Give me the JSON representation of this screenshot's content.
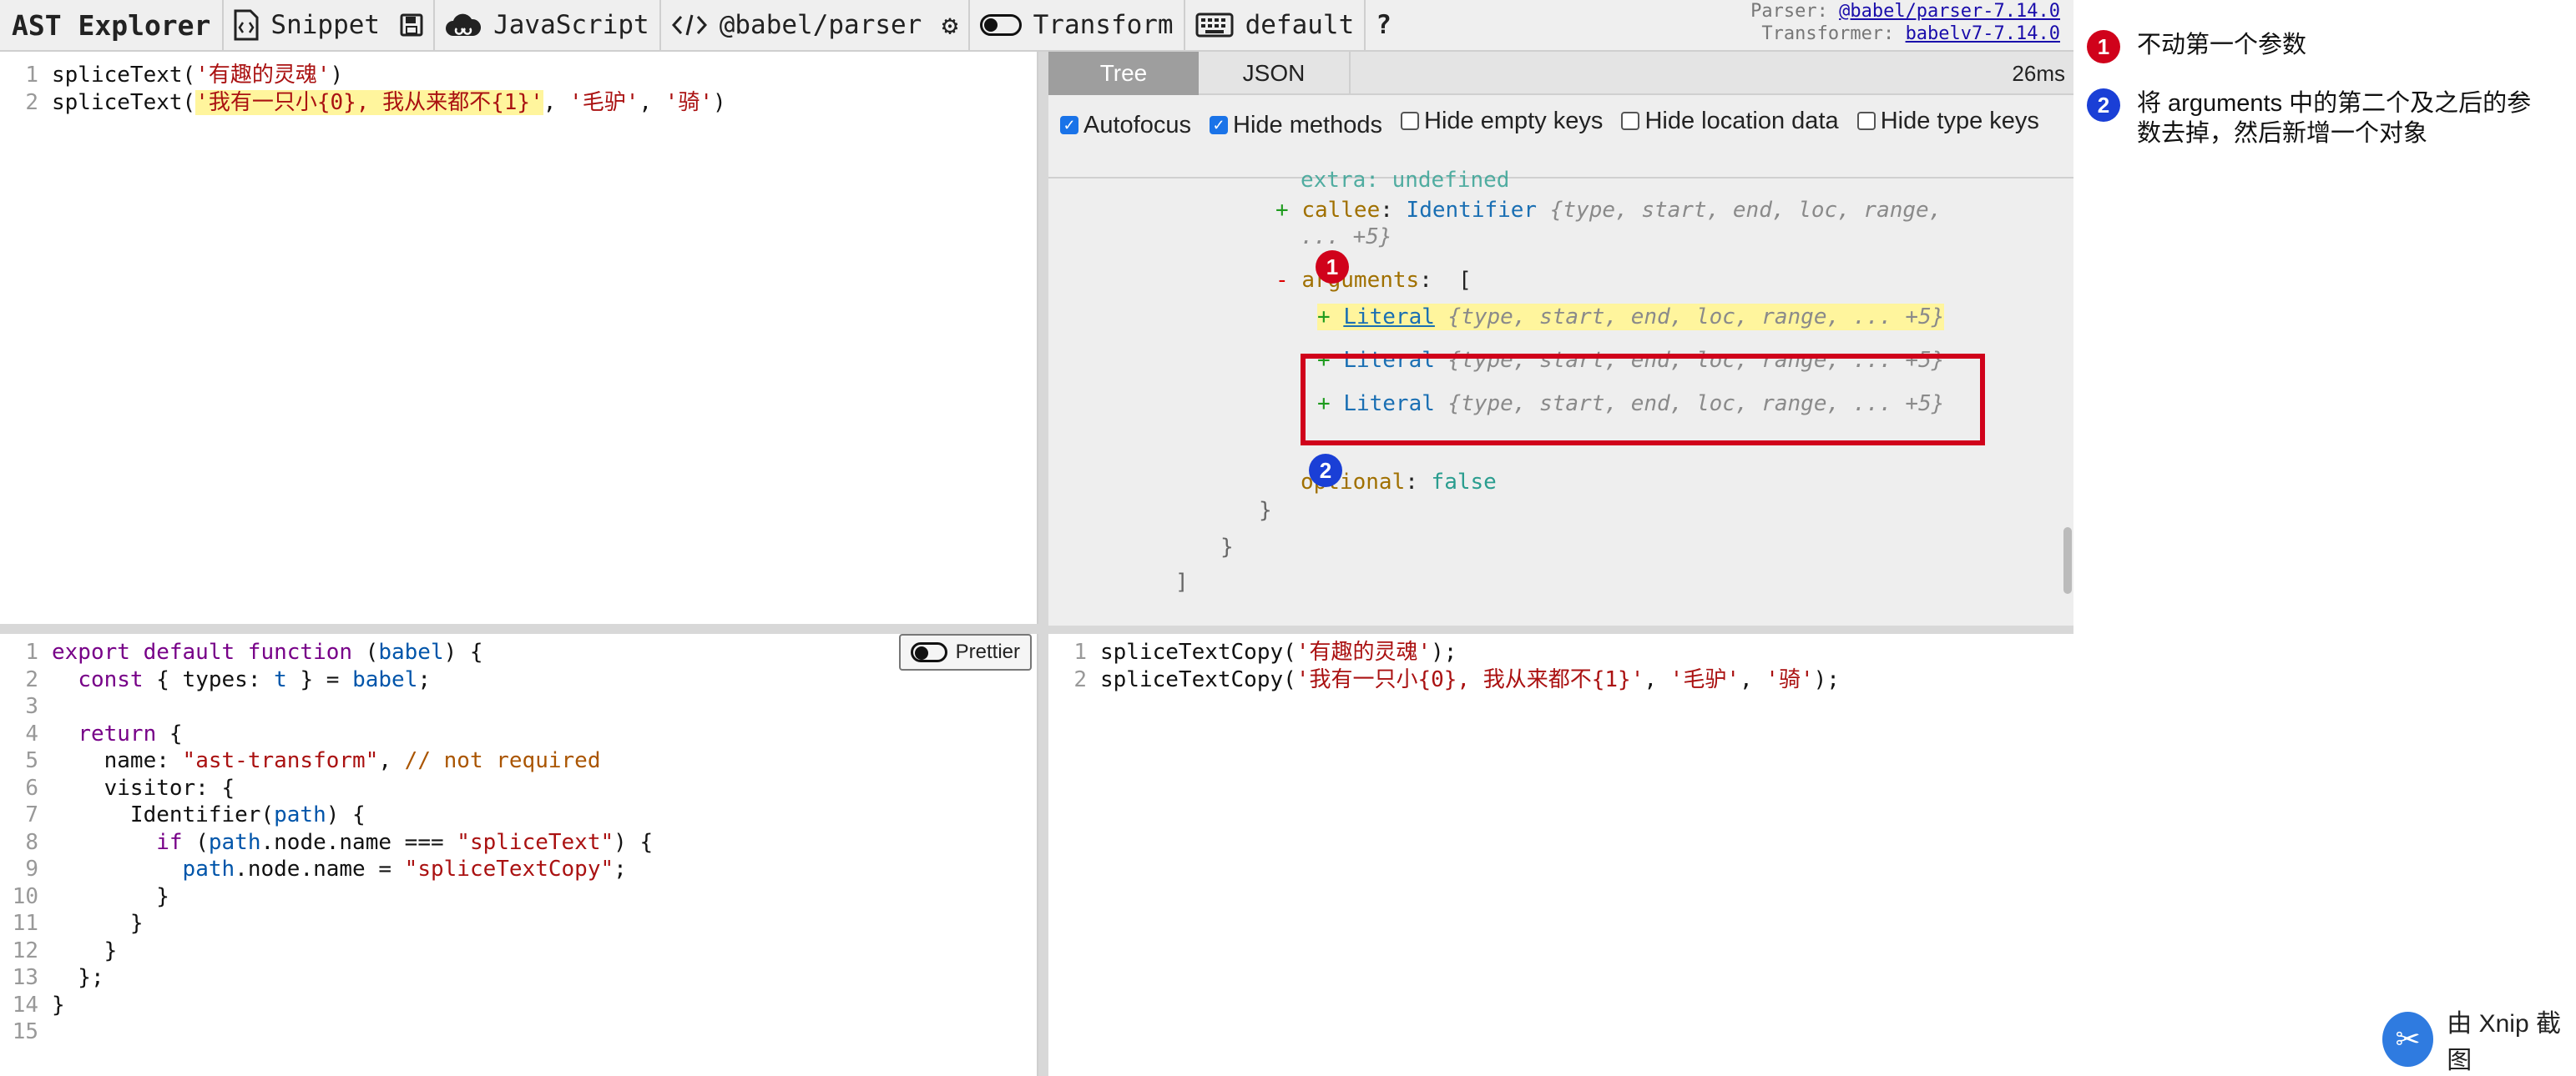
{
  "toolbar": {
    "brand": "AST Explorer",
    "snippet": "Snippet",
    "language": "JavaScript",
    "parser": "@babel/parser",
    "transform": "Transform",
    "keymap": "default",
    "help": "?",
    "parser_label": "Parser:",
    "parser_version": "@babel/parser-7.14.0",
    "transformer_label": "Transformer:",
    "transformer_version": "babelv7-7.14.0"
  },
  "source": {
    "lines": [
      {
        "n": "1",
        "pre": "spliceText(",
        "str": "'有趣的灵魂'",
        "post": ")"
      },
      {
        "n": "2",
        "pre": "spliceText(",
        "str": "'我有一只小{0}, 我从来都不{1}'",
        "mid": ", ",
        "str2": "'毛驴'",
        "mid2": ", ",
        "str3": "'骑'",
        "post": ")"
      }
    ]
  },
  "ast": {
    "tab_tree": "Tree",
    "tab_json": "JSON",
    "time": "26ms",
    "options": [
      {
        "label": "Autofocus",
        "checked": true
      },
      {
        "label": "Hide methods",
        "checked": true
      },
      {
        "label": "Hide empty keys",
        "checked": false
      },
      {
        "label": "Hide location data",
        "checked": false
      },
      {
        "label": "Hide type keys",
        "checked": false
      }
    ],
    "tree": {
      "extra_line": "extra: undefined",
      "callee_key": "callee",
      "callee_type": "Identifier",
      "callee_meta": "{type, start, end, loc, range,",
      "callee_meta2": "... +5}",
      "arguments_key": "arguments",
      "literal": "Literal",
      "literal_meta": "{type, start, end, loc, range, ... +5}",
      "optional_key": "optional",
      "optional_val": "false"
    }
  },
  "transform": {
    "prettier": "Prettier",
    "lines": [
      "1",
      "2",
      "3",
      "4",
      "5",
      "6",
      "7",
      "8",
      "9",
      "10",
      "11",
      "12",
      "13",
      "14",
      "15"
    ]
  },
  "output": {
    "lines": [
      {
        "n": "1",
        "pre": "spliceTextCopy(",
        "str": "'有趣的灵魂'",
        "post": ");"
      },
      {
        "n": "2",
        "pre": "spliceTextCopy(",
        "str": "'我有一只小{0}, 我从来都不{1}'",
        "mid": ", ",
        "str2": "'毛驴'",
        "mid2": ", ",
        "str3": "'骑'",
        "post": ");"
      }
    ]
  },
  "notes": [
    {
      "num": "1",
      "text": "不动第一个参数",
      "color": "#d0021b"
    },
    {
      "num": "2",
      "text": "将 arguments 中的第二个及之后的参数去掉，然后新增一个对象",
      "color": "#1a3fd6"
    }
  ],
  "watermark": "由 Xnip 截图"
}
